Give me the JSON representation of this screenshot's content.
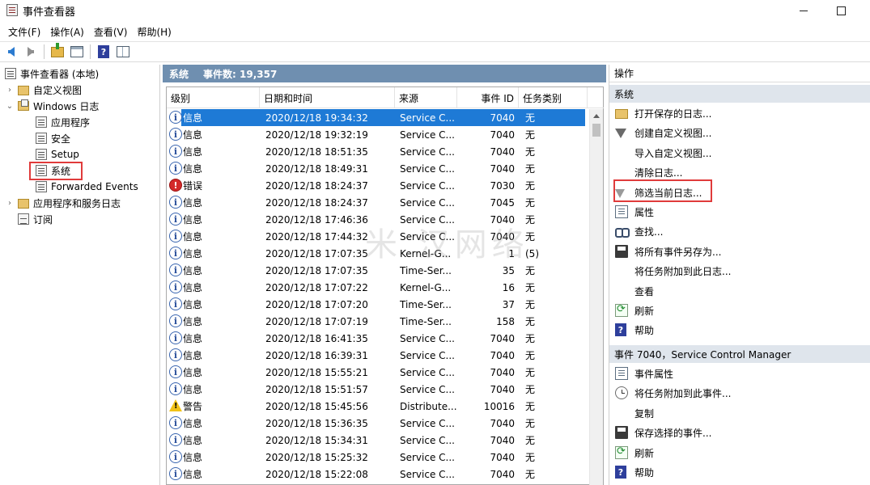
{
  "window": {
    "title": "事件查看器"
  },
  "menu": [
    "文件(F)",
    "操作(A)",
    "查看(V)",
    "帮助(H)"
  ],
  "tree": {
    "root": "事件查看器 (本地)",
    "custom_views": "自定义视图",
    "windows_logs": "Windows 日志",
    "logs": [
      "应用程序",
      "安全",
      "Setup",
      "系统",
      "Forwarded Events"
    ],
    "app_services": "应用程序和服务日志",
    "subscriptions": "订阅"
  },
  "middle": {
    "log_name": "系统",
    "event_count": "事件数: 19,357",
    "columns": [
      "级别",
      "日期和时间",
      "来源",
      "事件 ID",
      "任务类别"
    ],
    "rows": [
      {
        "level": "info",
        "level_text": "信息",
        "datetime": "2020/12/18 19:34:32",
        "source": "Service C...",
        "id": "7040",
        "task": "无"
      },
      {
        "level": "info",
        "level_text": "信息",
        "datetime": "2020/12/18 19:32:19",
        "source": "Service C...",
        "id": "7040",
        "task": "无"
      },
      {
        "level": "info",
        "level_text": "信息",
        "datetime": "2020/12/18 18:51:35",
        "source": "Service C...",
        "id": "7040",
        "task": "无"
      },
      {
        "level": "info",
        "level_text": "信息",
        "datetime": "2020/12/18 18:49:31",
        "source": "Service C...",
        "id": "7040",
        "task": "无"
      },
      {
        "level": "error",
        "level_text": "错误",
        "datetime": "2020/12/18 18:24:37",
        "source": "Service C...",
        "id": "7030",
        "task": "无"
      },
      {
        "level": "info",
        "level_text": "信息",
        "datetime": "2020/12/18 18:24:37",
        "source": "Service C...",
        "id": "7045",
        "task": "无"
      },
      {
        "level": "info",
        "level_text": "信息",
        "datetime": "2020/12/18 17:46:36",
        "source": "Service C...",
        "id": "7040",
        "task": "无"
      },
      {
        "level": "info",
        "level_text": "信息",
        "datetime": "2020/12/18 17:44:32",
        "source": "Service C...",
        "id": "7040",
        "task": "无"
      },
      {
        "level": "info",
        "level_text": "信息",
        "datetime": "2020/12/18 17:07:35",
        "source": "Kernel-G...",
        "id": "1",
        "task": "(5)"
      },
      {
        "level": "info",
        "level_text": "信息",
        "datetime": "2020/12/18 17:07:35",
        "source": "Time-Ser...",
        "id": "35",
        "task": "无"
      },
      {
        "level": "info",
        "level_text": "信息",
        "datetime": "2020/12/18 17:07:22",
        "source": "Kernel-G...",
        "id": "16",
        "task": "无"
      },
      {
        "level": "info",
        "level_text": "信息",
        "datetime": "2020/12/18 17:07:20",
        "source": "Time-Ser...",
        "id": "37",
        "task": "无"
      },
      {
        "level": "info",
        "level_text": "信息",
        "datetime": "2020/12/18 17:07:19",
        "source": "Time-Ser...",
        "id": "158",
        "task": "无"
      },
      {
        "level": "info",
        "level_text": "信息",
        "datetime": "2020/12/18 16:41:35",
        "source": "Service C...",
        "id": "7040",
        "task": "无"
      },
      {
        "level": "info",
        "level_text": "信息",
        "datetime": "2020/12/18 16:39:31",
        "source": "Service C...",
        "id": "7040",
        "task": "无"
      },
      {
        "level": "info",
        "level_text": "信息",
        "datetime": "2020/12/18 15:55:21",
        "source": "Service C...",
        "id": "7040",
        "task": "无"
      },
      {
        "level": "info",
        "level_text": "信息",
        "datetime": "2020/12/18 15:51:57",
        "source": "Service C...",
        "id": "7040",
        "task": "无"
      },
      {
        "level": "warning",
        "level_text": "警告",
        "datetime": "2020/12/18 15:45:56",
        "source": "Distribute...",
        "id": "10016",
        "task": "无"
      },
      {
        "level": "info",
        "level_text": "信息",
        "datetime": "2020/12/18 15:36:35",
        "source": "Service C...",
        "id": "7040",
        "task": "无"
      },
      {
        "level": "info",
        "level_text": "信息",
        "datetime": "2020/12/18 15:34:31",
        "source": "Service C...",
        "id": "7040",
        "task": "无"
      },
      {
        "level": "info",
        "level_text": "信息",
        "datetime": "2020/12/18 15:25:32",
        "source": "Service C...",
        "id": "7040",
        "task": "无"
      },
      {
        "level": "info",
        "level_text": "信息",
        "datetime": "2020/12/18 15:22:08",
        "source": "Service C...",
        "id": "7040",
        "task": "无"
      }
    ],
    "watermark": "米 汉网络"
  },
  "actions": {
    "title": "操作",
    "section1": {
      "title": "系统",
      "items": [
        {
          "icon": "open-folder-icon",
          "label": "打开保存的日志..."
        },
        {
          "icon": "filter-icon",
          "label": "创建自定义视图..."
        },
        {
          "icon": "",
          "label": "导入自定义视图..."
        },
        {
          "icon": "",
          "label": "清除日志..."
        },
        {
          "icon": "filter-icon",
          "label": "筛选当前日志..."
        },
        {
          "icon": "properties-icon",
          "label": "属性"
        },
        {
          "icon": "find-icon",
          "label": "查找..."
        },
        {
          "icon": "save-icon",
          "label": "将所有事件另存为..."
        },
        {
          "icon": "",
          "label": "将任务附加到此日志..."
        },
        {
          "icon": "",
          "label": "查看"
        },
        {
          "icon": "refresh-icon",
          "label": "刷新"
        },
        {
          "icon": "help-icon",
          "label": "帮助"
        }
      ]
    },
    "section2": {
      "title": "事件 7040，Service Control Manager",
      "items": [
        {
          "icon": "properties-icon",
          "label": "事件属性"
        },
        {
          "icon": "task-icon",
          "label": "将任务附加到此事件..."
        },
        {
          "icon": "",
          "label": "复制"
        },
        {
          "icon": "save-icon",
          "label": "保存选择的事件..."
        },
        {
          "icon": "refresh-icon",
          "label": "刷新"
        },
        {
          "icon": "help-icon",
          "label": "帮助"
        }
      ]
    }
  },
  "colors": {
    "selection": "#1e7ad6",
    "header": "#6f8fb0",
    "highlight": "#e03b3b"
  }
}
